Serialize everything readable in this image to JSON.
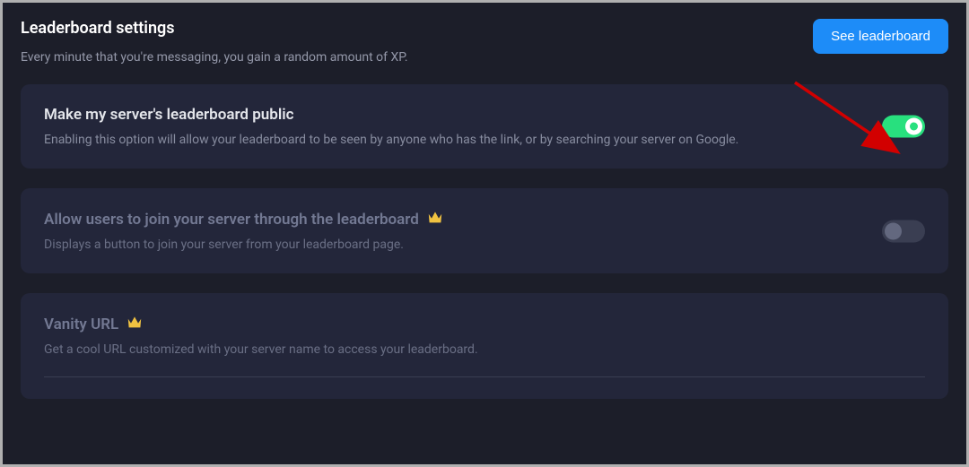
{
  "header": {
    "title": "Leaderboard settings",
    "subtitle": "Every minute that you're messaging, you gain a random amount of XP.",
    "see_button": "See leaderboard"
  },
  "cards": [
    {
      "title": "Make my server's leaderboard public",
      "desc": "Enabling this option will allow your leaderboard to be seen by anyone who has the link, or by searching your server on Google.",
      "toggle": "on"
    },
    {
      "title": "Allow users to join your server through the leaderboard",
      "desc": "Displays a button to join your server from your leaderboard page.",
      "toggle": "off"
    },
    {
      "title": "Vanity URL",
      "desc": "Get a cool URL customized with your server name to access your leaderboard."
    }
  ],
  "colors": {
    "accent": "#1d8cf8",
    "toggle_on": "#28e07e",
    "arrow": "#d20000"
  }
}
